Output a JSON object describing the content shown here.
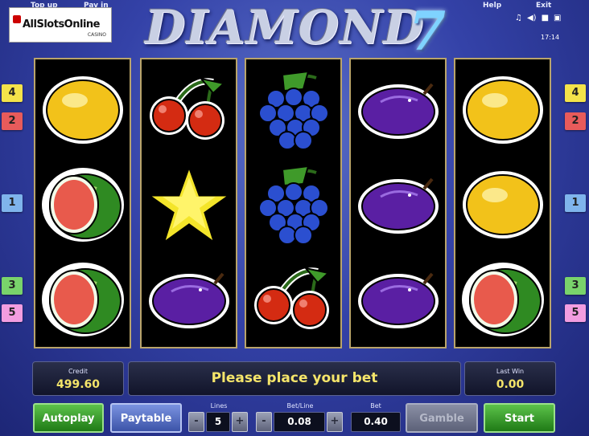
{
  "topbar": {
    "top_up": "Top up",
    "pay_in": "Pay in",
    "help": "Help",
    "exit": "Exit",
    "clock": "17:14",
    "icons": [
      "music-icon",
      "volume-icon",
      "screen-icon",
      "fullscreen-icon"
    ]
  },
  "logo": {
    "brand": "AllSlotsOnline",
    "sub": "CASINO"
  },
  "game": {
    "title": "DIAMOND",
    "title_seven": "7"
  },
  "lines_left": [
    {
      "label": "4",
      "color": "#f4e34a"
    },
    {
      "label": "2",
      "color": "#e85b5b"
    },
    {
      "label": "1",
      "color": "#7fb4ec"
    },
    {
      "label": "3",
      "color": "#79d36b"
    },
    {
      "label": "5",
      "color": "#f29de0"
    }
  ],
  "lines_right": [
    {
      "label": "4",
      "color": "#f4e34a"
    },
    {
      "label": "2",
      "color": "#e85b5b"
    },
    {
      "label": "1",
      "color": "#7fb4ec"
    },
    {
      "label": "3",
      "color": "#79d36b"
    },
    {
      "label": "5",
      "color": "#f29de0"
    }
  ],
  "reels": [
    [
      "lemon",
      "watermelon",
      "watermelon"
    ],
    [
      "cherries",
      "star",
      "plum"
    ],
    [
      "grapes",
      "grapes",
      "cherries"
    ],
    [
      "plum",
      "plum",
      "plum"
    ],
    [
      "lemon",
      "lemon",
      "watermelon"
    ]
  ],
  "status": {
    "credit_label": "Credit",
    "credit_value": "499.60",
    "message": "Please place your bet",
    "lastwin_label": "Last Win",
    "lastwin_value": "0.00"
  },
  "controls": {
    "autoplay": "Autoplay",
    "paytable": "Paytable",
    "lines_label": "Lines",
    "lines_value": "5",
    "betline_label": "Bet/Line",
    "betline_value": "0.08",
    "bet_label": "Bet",
    "bet_value": "0.40",
    "gamble": "Gamble",
    "start": "Start",
    "minus": "-",
    "plus": "+"
  },
  "colors": {
    "accent_yellow": "#f5e56a",
    "button_green": "#1f7a16",
    "button_blue": "#3c53a8",
    "reel_frame": "#b9a46a"
  }
}
